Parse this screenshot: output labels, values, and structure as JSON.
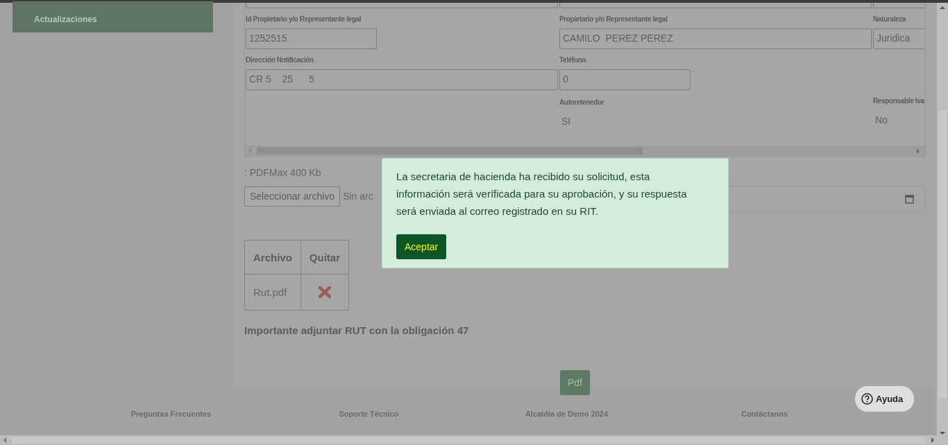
{
  "sidebar": {
    "items": [
      {
        "label": "Actualizaciones"
      }
    ]
  },
  "form": {
    "fields": [
      {
        "kind": "input",
        "label": "Id Propietario y/o Representante legal",
        "value": "1252515"
      },
      {
        "kind": "input",
        "label": "Propietario y/o Representante legal",
        "value": "CAMILO  PEREZ PEREZ"
      },
      {
        "kind": "input",
        "label": "Naturaleza",
        "value": "Juridica"
      },
      {
        "kind": "input",
        "label": "Dirección Notificación",
        "value": "CR 5    25      5"
      },
      {
        "kind": "input",
        "label": "Teléfono",
        "value": "0"
      },
      {
        "kind": "text",
        "label": "Autoretenedor",
        "value": "SI"
      },
      {
        "kind": "text",
        "label": "Responsable Iva",
        "value": "No"
      }
    ]
  },
  "upload": {
    "hint": ": PDFMax 400 Kb",
    "button": "Seleccionar archivo",
    "status": "Sin arc"
  },
  "files_table": {
    "columns": [
      "Archivo",
      "Quitar"
    ],
    "rows": [
      {
        "file": "Rut.pdf"
      }
    ]
  },
  "note": "Importante adjuntar RUT con la obligación 47",
  "pdf_button": "Pdf",
  "footer": {
    "links": [
      "Preguntas Frecuentes",
      "Soporte Técnico",
      "Alcaldía de Demo 2024",
      "Contáctanos"
    ]
  },
  "dialog": {
    "message": "La secretaria de hacienda ha recibido su solicitud, esta información será veríficada para su aprobación, y su respuesta será enviada al correo registrado en su RIT.",
    "button": "Aceptar"
  },
  "help_button": "Ayuda"
}
